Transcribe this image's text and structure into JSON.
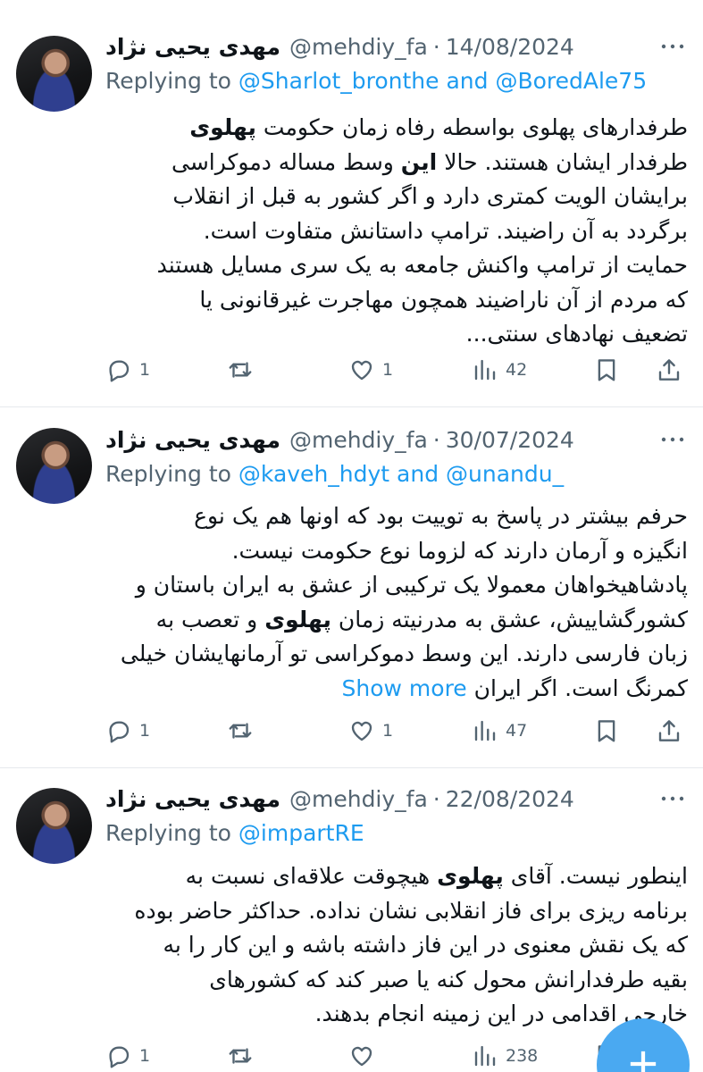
{
  "tweets": [
    {
      "author_name": "مهدی یحیی نژاد",
      "handle": "@mehdiy_fa",
      "separator": "·",
      "date": "14/08/2024",
      "replying_prefix": "Replying to",
      "replying_mentions": "@Sharlot_bronthe and @BoredAle75",
      "body_lines": [
        "طرفدارهای پهلوی بواسطه رفاه زمان حکومت پهلوی",
        "طرفدار ایشان هستند. حالا این وسط مساله دموکراسی",
        "برایشان الویت کمتری دارد و اگر کشور به قبل از انقلاب",
        "برگردد به آن راضیند. ترامپ داستانش متفاوت است.",
        "حمایت از ترامپ واکنش جامعه به یک سری مسایل هستند",
        "که مردم از آن ناراضیند همچون مهاجرت غیرقانونی یا",
        "تضعیف نهادهای سنتی..."
      ],
      "show_more": "",
      "replies": "1",
      "retweets": "",
      "likes": "1",
      "views": "42"
    },
    {
      "author_name": "مهدی یحیی نژاد",
      "handle": "@mehdiy_fa",
      "separator": "·",
      "date": "30/07/2024",
      "replying_prefix": "Replying to",
      "replying_mentions": "@kaveh_hdyt and @unandu_",
      "body_lines": [
        "حرفم بیشتر در پاسخ به توییت بود که اونها هم یک نوع",
        "انگیزه و آرمان دارند که لزوما نوع حکومت نیست.",
        "پادشاهیخواهان معمولا یک ترکیبی از عشق به ایران باستان و",
        "کشورگشاییش، عشق به مدرنیته زمان پهلوی و تعصب به",
        "زبان فارسی دارند. این وسط دموکراسی تو آرمانهایشان خیلی",
        "کمرنگ است. اگر ایران"
      ],
      "show_more": "Show more",
      "replies": "1",
      "retweets": "",
      "likes": "1",
      "views": "47"
    },
    {
      "author_name": "مهدی یحیی نژاد",
      "handle": "@mehdiy_fa",
      "separator": "·",
      "date": "22/08/2024",
      "replying_prefix": "Replying to",
      "replying_mentions": "@impartRE",
      "body_lines": [
        "اینطور نیست. آقای پهلوی هیچوقت علاقه‌ای نسبت به",
        "برنامه ریزی برای فاز انقلابی نشان نداده. حداکثر حاضر بوده",
        "که یک نقش معنوی در این فاز داشته باشه و این کار را به",
        "بقیه طرفدارانش محول کنه یا صبر کند که کشورهای",
        "خارجی اقدامی در این زمینه انجام بدهند."
      ],
      "show_more": "",
      "replies": "1",
      "retweets": "",
      "likes": "",
      "views": "238"
    }
  ],
  "colors": {
    "link": "#1d9bf0",
    "secondary_text": "#536471",
    "divider": "#e6e9ec",
    "fab": "#4aa9f1"
  },
  "icons": [
    "reply-icon",
    "retweet-icon",
    "like-icon",
    "views-icon",
    "bookmark-icon",
    "share-icon",
    "more-options-icon",
    "compose-icon"
  ]
}
